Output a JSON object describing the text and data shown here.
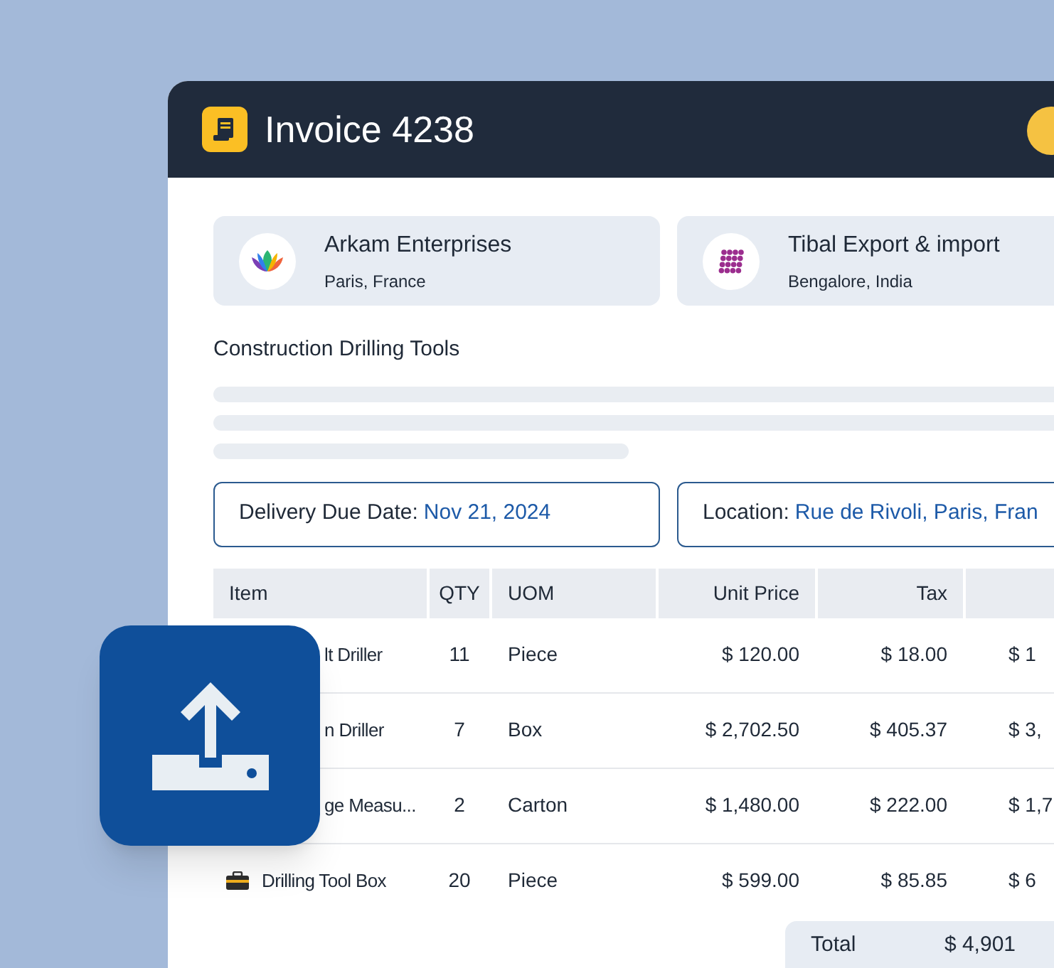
{
  "invoice": {
    "title": "Invoice 4238"
  },
  "parties": [
    {
      "name": "Arkam Enterprises",
      "location": "Paris, France",
      "kind": "lotus"
    },
    {
      "name": "Tibal Export & import",
      "location": "Bengalore, India",
      "kind": "dots"
    }
  ],
  "description": "Construction Drilling Tools",
  "fields": [
    {
      "label": "Delivery Due Date:",
      "value": "Nov 21, 2024"
    },
    {
      "label": "Location:",
      "value": "Rue de Rivoli, Paris, Fran"
    }
  ],
  "table": {
    "columns": [
      "Item",
      "QTY",
      "UOM",
      "Unit Price",
      "Tax"
    ],
    "rows": [
      {
        "item": "lt Driller",
        "qty": "11",
        "uom": "Piece",
        "unit_price": "$ 120.00",
        "tax": "$ 18.00",
        "column_6": "$ 1",
        "toolbox_icon": false
      },
      {
        "item": "n Driller",
        "qty": "7",
        "uom": "Box",
        "unit_price": "$ 2,702.50",
        "tax": "$ 405.37",
        "column_6": "$ 3,",
        "toolbox_icon": false
      },
      {
        "item": "ge Measu...",
        "qty": "2",
        "uom": "Carton",
        "unit_price": "$ 1,480.00",
        "tax": "$ 222.00",
        "column_6": "$ 1,7",
        "toolbox_icon": false
      },
      {
        "item": "Drilling Tool Box",
        "qty": "20",
        "uom": "Piece",
        "unit_price": "$ 599.00",
        "tax": "$ 85.85",
        "column_6": "$ 6",
        "toolbox_icon": true
      }
    ]
  },
  "total": {
    "label": "Total",
    "value": "$ 4,901"
  }
}
